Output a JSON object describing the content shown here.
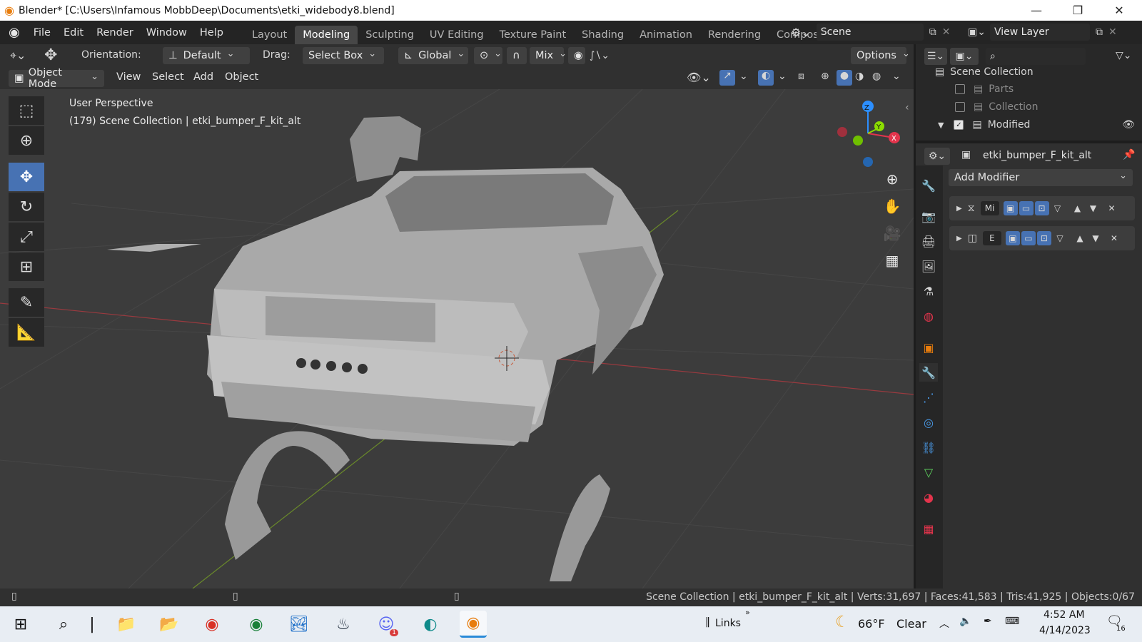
{
  "window": {
    "title": "Blender* [C:\\Users\\Infamous MobbDeep\\Documents\\etki_widebody8.blend]",
    "minimize": "—",
    "restore": "❐",
    "close": "✕"
  },
  "menubar": {
    "items": [
      "File",
      "Edit",
      "Render",
      "Window",
      "Help"
    ],
    "workspaces": [
      "Layout",
      "Modeling",
      "Sculpting",
      "UV Editing",
      "Texture Paint",
      "Shading",
      "Animation",
      "Rendering",
      "Compositin"
    ],
    "active_workspace": "Modeling",
    "scene": "Scene",
    "view_layer": "View Layer"
  },
  "tool_header": {
    "orientation_label": "Orientation:",
    "orientation_value": "Default",
    "drag_label": "Drag:",
    "drag_value": "Select Box",
    "transform_value": "Global",
    "snap_value": "Mix",
    "options_label": "Options"
  },
  "view_header": {
    "mode": "Object Mode",
    "menus": [
      "View",
      "Select",
      "Add",
      "Object"
    ]
  },
  "viewport": {
    "perspective": "User Perspective",
    "info": "(179) Scene Collection | etki_bumper_F_kit_alt",
    "gizmo": {
      "z": "Z",
      "y": "Y",
      "x": "X"
    }
  },
  "outliner": {
    "rows": [
      {
        "label": "Scene Collection"
      },
      {
        "label": "Parts"
      },
      {
        "label": "Collection"
      },
      {
        "label": "Modified"
      }
    ]
  },
  "properties": {
    "object_name": "etki_bumper_F_kit_alt",
    "add_modifier": "Add Modifier",
    "modifiers": [
      {
        "short": "Mi"
      },
      {
        "short": "E"
      }
    ]
  },
  "statusbar": {
    "stats": "Scene Collection | etki_bumper_F_kit_alt | Verts:31,697 | Faces:41,583 | Tris:41,925 | Objects:0/67"
  },
  "taskbar": {
    "links": "Links",
    "weather_temp": "66°F",
    "weather_cond": "Clear",
    "time": "4:52 AM",
    "date": "4/14/2023",
    "notifications": "16",
    "discord_badge": "1"
  },
  "colors": {
    "accent": "#4772b3",
    "viewport_bg": "#3c3c3c",
    "axis_x": "#e3344c",
    "axis_y": "#8bdc00",
    "axis_z": "#2c8fff"
  }
}
